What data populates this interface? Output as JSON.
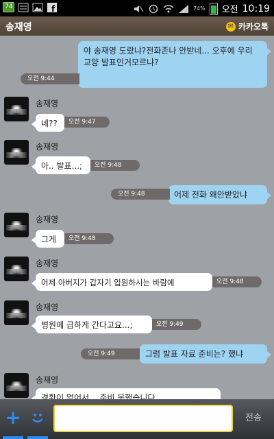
{
  "status_bar": {
    "badge": "74",
    "battery": "74%",
    "time_prefix": "오전",
    "time": "10:19"
  },
  "header": {
    "title": "송재영",
    "brand": "카카오톡"
  },
  "messages": [
    {
      "side": "me",
      "text": "야 송재영 도랐냐?전화존나 안받네... 오후에 우리 교양 발표인거모르냐?",
      "time": "오전 9:44"
    },
    {
      "side": "you",
      "sender": "송재영",
      "text": "네??",
      "time": "오전 9:47"
    },
    {
      "side": "you",
      "sender": "송재영",
      "text": "아.. 발표...;",
      "time": "오전 9:48"
    },
    {
      "side": "me",
      "text": "어제 전화 왜안받았냐",
      "time": "오전 9:48"
    },
    {
      "side": "you",
      "sender": "송재영",
      "text": "그게",
      "time": "오전 9:48"
    },
    {
      "side": "you",
      "sender": "송재영",
      "text": "어제 아버지가 갑자기 입원하시는 바람에",
      "time": "오전 9:48"
    },
    {
      "side": "you",
      "sender": "송재영",
      "text": "병원에 급하게 간다고요...;",
      "time": "오전 9:49"
    },
    {
      "side": "me",
      "text": "그럼 발표 자료 준비는? 했냐",
      "time": "오전 9:49"
    },
    {
      "side": "you",
      "sender": "송재영",
      "text": "경황이 없어서... 준비 못했습니다",
      "time": ""
    }
  ],
  "input": {
    "add_icon": "+",
    "emoticon_icon": "ᴗ",
    "placeholder": "",
    "send_label": "전송"
  },
  "colors": {
    "chat_background": "#9ea2a7",
    "my_bubble": "#9fd3f2",
    "their_bubble": "#ffffff",
    "accent": "#2c8cf0",
    "input_border": "#f2cf3a"
  },
  "icons": [
    "sim-icon",
    "gallery-icon",
    "facebook-icon",
    "mute-icon",
    "alarm-icon",
    "wifi-icon",
    "signal-icon",
    "battery-icon",
    "kakao-logo-icon",
    "plus-icon",
    "emoticon-icon"
  ]
}
